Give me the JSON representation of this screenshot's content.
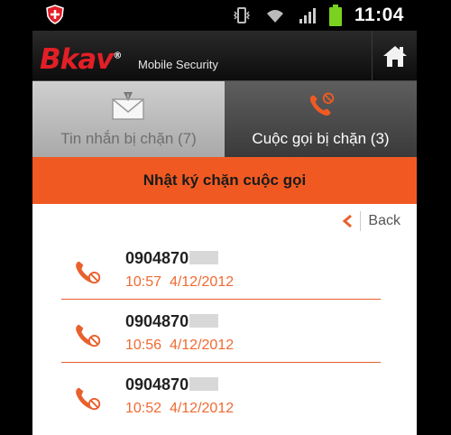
{
  "status_bar": {
    "time": "11:04"
  },
  "header": {
    "logo": "Bkav",
    "logo_trademark": "®",
    "subtitle": "Mobile Security"
  },
  "tabs": [
    {
      "label": "Tin nhắn bị chặn (7)",
      "icon": "envelope-warning-icon",
      "active": false
    },
    {
      "label": "Cuộc gọi bị chặn (3)",
      "icon": "blocked-call-icon",
      "active": true
    }
  ],
  "title": "Nhật ký chặn cuộc gọi",
  "back_label": "Back",
  "calls": [
    {
      "number": "0904870",
      "time": "10:57",
      "date": "4/12/2012"
    },
    {
      "number": "0904870",
      "time": "10:56",
      "date": "4/12/2012"
    },
    {
      "number": "0904870",
      "time": "10:52",
      "date": "4/12/2012"
    }
  ],
  "colors": {
    "accent": "#f05a22",
    "brand_red": "#e21f26"
  }
}
